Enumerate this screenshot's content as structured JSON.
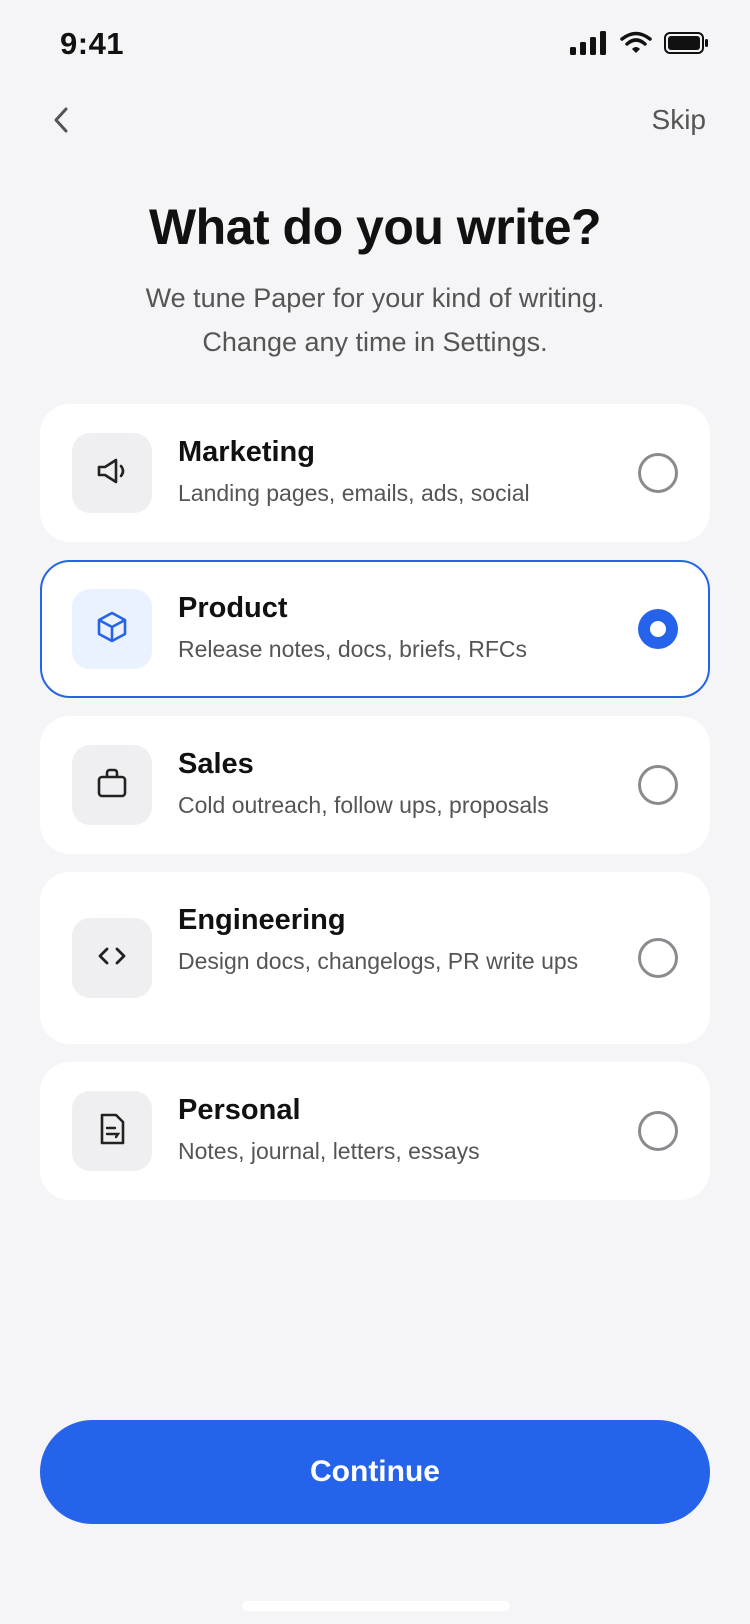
{
  "status_bar": {
    "time": "9:41"
  },
  "nav": {
    "skip_label": "Skip"
  },
  "header": {
    "title": "What do you write?",
    "subtitle_line1": "We tune Paper for your kind of writing.",
    "subtitle_line2": "Change any time in Settings."
  },
  "options": [
    {
      "title": "Marketing",
      "description": "Landing pages, emails, ads, social",
      "icon": "megaphone-icon",
      "selected": false
    },
    {
      "title": "Product",
      "description": "Release notes, docs, briefs, RFCs",
      "icon": "cube-icon",
      "selected": true
    },
    {
      "title": "Sales",
      "description": "Cold outreach, follow ups, proposals",
      "icon": "briefcase-icon",
      "selected": false
    },
    {
      "title": "Engineering",
      "description": "Design docs, changelogs, PR write ups",
      "icon": "code-icon",
      "selected": false
    },
    {
      "title": "Personal",
      "description": "Notes, journal, letters, essays",
      "icon": "document-icon",
      "selected": false
    }
  ],
  "footer": {
    "continue_label": "Continue"
  },
  "colors": {
    "accent": "#2563eb",
    "background": "#f5f5f7",
    "card": "#ffffff"
  }
}
